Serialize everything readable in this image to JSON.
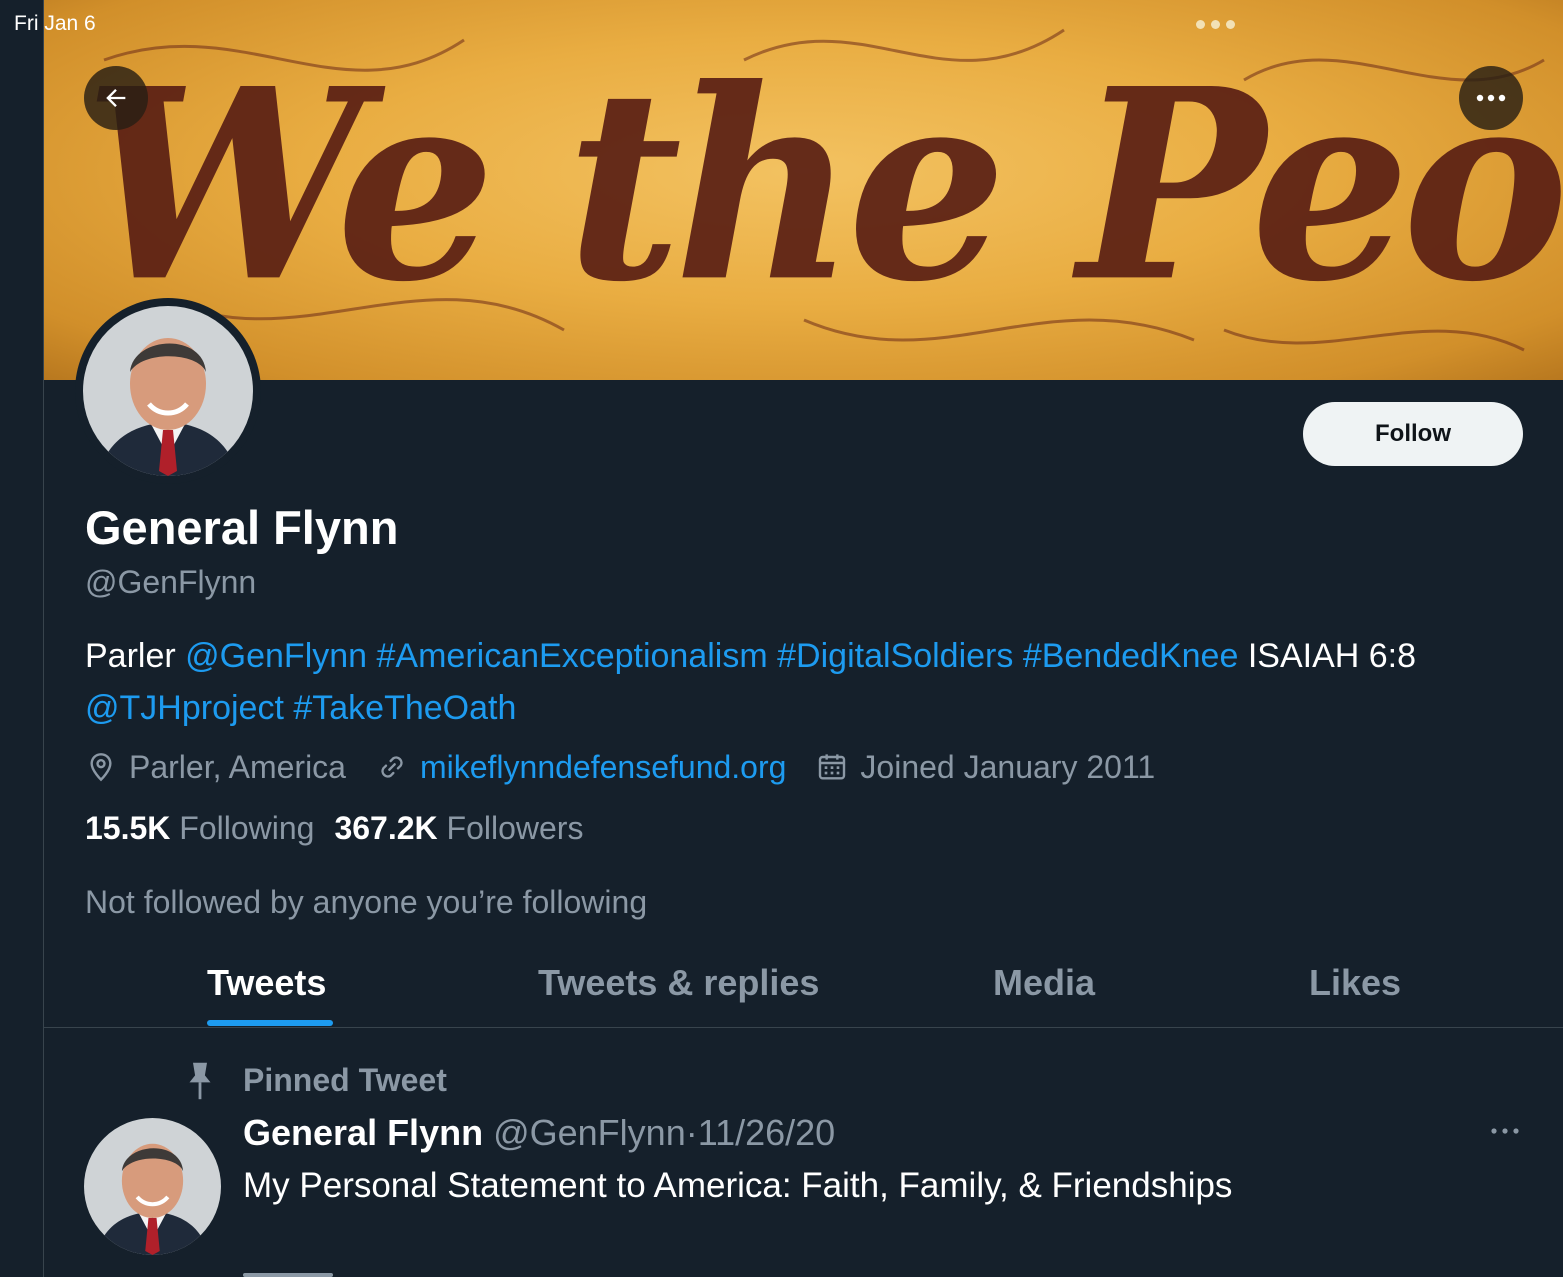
{
  "status_bar": {
    "date": "Fri Jan 6"
  },
  "banner": {
    "text": "We the People"
  },
  "icons": {
    "back": "arrow-left-icon",
    "more": "ellipsis-icon",
    "location": "location-pin-icon",
    "website": "link-icon",
    "joined": "calendar-icon",
    "pin": "pin-icon"
  },
  "profile": {
    "display_name": "General Flynn",
    "handle": "@GenFlynn",
    "follow_label": "Follow",
    "bio": {
      "prefix": "Parler ",
      "mention1": "@GenFlynn",
      "tag1": "#AmericanExceptionalism",
      "tag2": "#DigitalSoldiers",
      "tag3": "#BendedKnee",
      "mid": "ISAIAH 6:8",
      "mention2": "@TJHproject",
      "tag4": "#TakeTheOath"
    },
    "location": "Parler, America",
    "website": "mikeflynndefensefund.org",
    "joined": "Joined January 2011",
    "following_count": "15.5K",
    "following_label": "Following",
    "followers_count": "367.2K",
    "followers_label": "Followers",
    "not_followed": "Not followed by anyone you’re following"
  },
  "tabs": [
    {
      "label": "Tweets",
      "active": true
    },
    {
      "label": "Tweets & replies",
      "active": false
    },
    {
      "label": "Media",
      "active": false
    },
    {
      "label": "Likes",
      "active": false
    }
  ],
  "pinned_tweet": {
    "label": "Pinned Tweet",
    "author": "General Flynn",
    "handle": "@GenFlynn",
    "separator": "·",
    "date": "11/26/20",
    "text": "My Personal Statement to America: Faith, Family, & Friendships"
  },
  "colors": {
    "background": "#15202b",
    "accent": "#1d9bf0",
    "secondary_text": "#8b98a5",
    "banner_ink": "#5a1f14",
    "banner_parchment": "#e9ad42"
  }
}
